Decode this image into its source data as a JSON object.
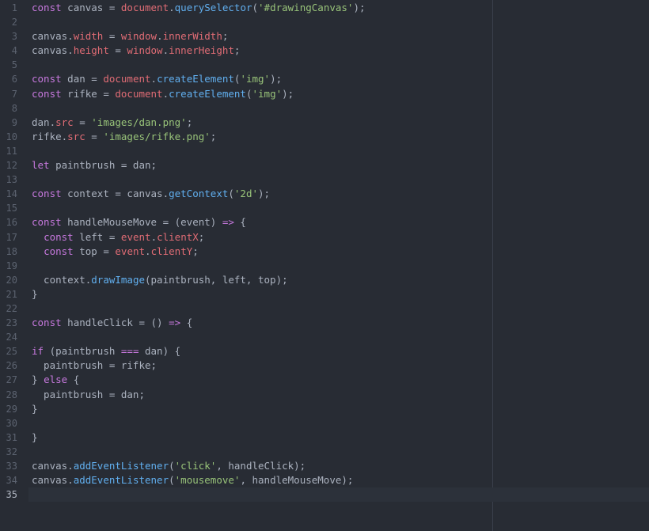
{
  "colors": {
    "background": "#282c34",
    "keyword": "#c678dd",
    "variable": "#e06c75",
    "function": "#61afef",
    "string": "#98c379",
    "plain": "#abb2bf",
    "line_number": "#5c6370"
  },
  "current_line": 35,
  "lines": [
    {
      "n": "1",
      "tokens": [
        [
          "kw",
          "const"
        ],
        [
          "plain",
          " canvas = "
        ],
        [
          "var",
          "document"
        ],
        [
          "plain",
          "."
        ],
        [
          "fn",
          "querySelector"
        ],
        [
          "plain",
          "("
        ],
        [
          "str",
          "'#drawingCanvas'"
        ],
        [
          "plain",
          ");"
        ]
      ]
    },
    {
      "n": "2",
      "tokens": []
    },
    {
      "n": "3",
      "tokens": [
        [
          "plain",
          "canvas."
        ],
        [
          "var",
          "width"
        ],
        [
          "plain",
          " = "
        ],
        [
          "var",
          "window"
        ],
        [
          "plain",
          "."
        ],
        [
          "var",
          "innerWidth"
        ],
        [
          "plain",
          ";"
        ]
      ]
    },
    {
      "n": "4",
      "tokens": [
        [
          "plain",
          "canvas."
        ],
        [
          "var",
          "height"
        ],
        [
          "plain",
          " = "
        ],
        [
          "var",
          "window"
        ],
        [
          "plain",
          "."
        ],
        [
          "var",
          "innerHeight"
        ],
        [
          "plain",
          ";"
        ]
      ]
    },
    {
      "n": "5",
      "tokens": []
    },
    {
      "n": "6",
      "tokens": [
        [
          "kw",
          "const"
        ],
        [
          "plain",
          " dan = "
        ],
        [
          "var",
          "document"
        ],
        [
          "plain",
          "."
        ],
        [
          "fn",
          "createElement"
        ],
        [
          "plain",
          "("
        ],
        [
          "str",
          "'img'"
        ],
        [
          "plain",
          ");"
        ]
      ]
    },
    {
      "n": "7",
      "tokens": [
        [
          "kw",
          "const"
        ],
        [
          "plain",
          " rifke = "
        ],
        [
          "var",
          "document"
        ],
        [
          "plain",
          "."
        ],
        [
          "fn",
          "createElement"
        ],
        [
          "plain",
          "("
        ],
        [
          "str",
          "'img'"
        ],
        [
          "plain",
          ");"
        ]
      ]
    },
    {
      "n": "8",
      "tokens": []
    },
    {
      "n": "9",
      "tokens": [
        [
          "plain",
          "dan."
        ],
        [
          "var",
          "src"
        ],
        [
          "plain",
          " = "
        ],
        [
          "str",
          "'images/dan.png'"
        ],
        [
          "plain",
          ";"
        ]
      ]
    },
    {
      "n": "10",
      "tokens": [
        [
          "plain",
          "rifke."
        ],
        [
          "var",
          "src"
        ],
        [
          "plain",
          " = "
        ],
        [
          "str",
          "'images/rifke.png'"
        ],
        [
          "plain",
          ";"
        ]
      ]
    },
    {
      "n": "11",
      "tokens": []
    },
    {
      "n": "12",
      "tokens": [
        [
          "kw",
          "let"
        ],
        [
          "plain",
          " paintbrush = dan;"
        ]
      ]
    },
    {
      "n": "13",
      "tokens": []
    },
    {
      "n": "14",
      "tokens": [
        [
          "kw",
          "const"
        ],
        [
          "plain",
          " context = canvas."
        ],
        [
          "fn",
          "getContext"
        ],
        [
          "plain",
          "("
        ],
        [
          "str",
          "'2d'"
        ],
        [
          "plain",
          ");"
        ]
      ]
    },
    {
      "n": "15",
      "tokens": []
    },
    {
      "n": "16",
      "tokens": [
        [
          "kw",
          "const"
        ],
        [
          "plain",
          " handleMouseMove = (event) "
        ],
        [
          "kw",
          "=>"
        ],
        [
          "plain",
          " {"
        ]
      ]
    },
    {
      "n": "17",
      "tokens": [
        [
          "plain",
          "  "
        ],
        [
          "kw",
          "const"
        ],
        [
          "plain",
          " left = "
        ],
        [
          "var",
          "event"
        ],
        [
          "plain",
          "."
        ],
        [
          "var",
          "clientX"
        ],
        [
          "plain",
          ";"
        ]
      ]
    },
    {
      "n": "18",
      "tokens": [
        [
          "plain",
          "  "
        ],
        [
          "kw",
          "const"
        ],
        [
          "plain",
          " top = "
        ],
        [
          "var",
          "event"
        ],
        [
          "plain",
          "."
        ],
        [
          "var",
          "clientY"
        ],
        [
          "plain",
          ";"
        ]
      ]
    },
    {
      "n": "19",
      "tokens": []
    },
    {
      "n": "20",
      "tokens": [
        [
          "plain",
          "  context."
        ],
        [
          "fn",
          "drawImage"
        ],
        [
          "plain",
          "(paintbrush, left, top);"
        ]
      ]
    },
    {
      "n": "21",
      "tokens": [
        [
          "plain",
          "}"
        ]
      ]
    },
    {
      "n": "22",
      "tokens": []
    },
    {
      "n": "23",
      "tokens": [
        [
          "kw",
          "const"
        ],
        [
          "plain",
          " handleClick = () "
        ],
        [
          "kw",
          "=>"
        ],
        [
          "plain",
          " {"
        ]
      ]
    },
    {
      "n": "24",
      "tokens": []
    },
    {
      "n": "25",
      "tokens": [
        [
          "kw",
          "if"
        ],
        [
          "plain",
          " (paintbrush "
        ],
        [
          "kw",
          "==="
        ],
        [
          "plain",
          " dan) {"
        ]
      ]
    },
    {
      "n": "26",
      "tokens": [
        [
          "plain",
          "  paintbrush = rifke;"
        ]
      ]
    },
    {
      "n": "27",
      "tokens": [
        [
          "plain",
          "} "
        ],
        [
          "kw",
          "else"
        ],
        [
          "plain",
          " {"
        ]
      ]
    },
    {
      "n": "28",
      "tokens": [
        [
          "plain",
          "  paintbrush = dan;"
        ]
      ]
    },
    {
      "n": "29",
      "tokens": [
        [
          "plain",
          "}"
        ]
      ]
    },
    {
      "n": "30",
      "tokens": []
    },
    {
      "n": "31",
      "tokens": [
        [
          "plain",
          "}"
        ]
      ]
    },
    {
      "n": "32",
      "tokens": []
    },
    {
      "n": "33",
      "tokens": [
        [
          "plain",
          "canvas."
        ],
        [
          "fn",
          "addEventListener"
        ],
        [
          "plain",
          "("
        ],
        [
          "str",
          "'click'"
        ],
        [
          "plain",
          ", handleClick);"
        ]
      ]
    },
    {
      "n": "34",
      "tokens": [
        [
          "plain",
          "canvas."
        ],
        [
          "fn",
          "addEventListener"
        ],
        [
          "plain",
          "("
        ],
        [
          "str",
          "'mousemove'"
        ],
        [
          "plain",
          ", handleMouseMove);"
        ]
      ]
    },
    {
      "n": "35",
      "tokens": []
    }
  ]
}
